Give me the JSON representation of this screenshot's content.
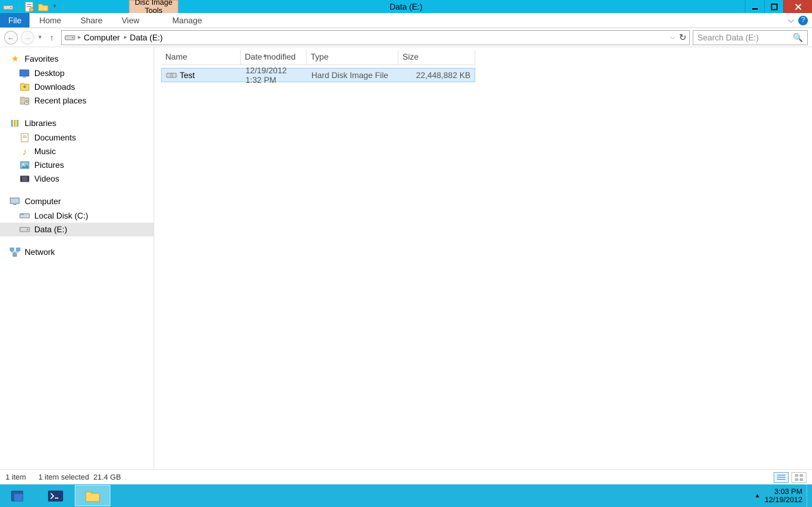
{
  "title": "Data (E:)",
  "contextual_tab": "Disc Image Tools",
  "ribbon": {
    "file": "File",
    "home": "Home",
    "share": "Share",
    "view": "View",
    "manage": "Manage"
  },
  "breadcrumb": {
    "root": "Computer",
    "current": "Data (E:)"
  },
  "search_placeholder": "Search Data (E:)",
  "navpane": {
    "favorites": {
      "label": "Favorites",
      "items": [
        "Desktop",
        "Downloads",
        "Recent places"
      ]
    },
    "libraries": {
      "label": "Libraries",
      "items": [
        "Documents",
        "Music",
        "Pictures",
        "Videos"
      ]
    },
    "computer": {
      "label": "Computer",
      "items": [
        "Local Disk (C:)",
        "Data (E:)"
      ]
    },
    "network": {
      "label": "Network"
    }
  },
  "columns": {
    "name": "Name",
    "date": "Date modified",
    "type": "Type",
    "size": "Size"
  },
  "file": {
    "name": "Test",
    "date": "12/19/2012 1:32 PM",
    "type": "Hard Disk Image File",
    "size": "22,448,882 KB"
  },
  "status": {
    "count": "1 item",
    "selected": "1 item selected",
    "selsize": "21.4 GB"
  },
  "tray": {
    "time": "3:03 PM",
    "date": "12/19/2012"
  }
}
